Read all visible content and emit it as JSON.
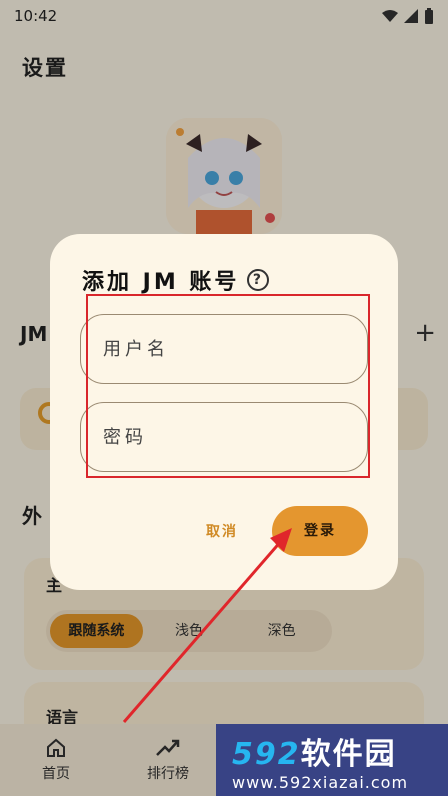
{
  "status_bar": {
    "time": "10:42"
  },
  "page": {
    "title": "设置",
    "section_jm": "JM",
    "section_appearance": "外",
    "theme_label": "主",
    "theme_options": [
      "跟随系统",
      "浅色",
      "深色"
    ],
    "language_label": "语言"
  },
  "bottom_nav": {
    "items": [
      {
        "label": "首页",
        "icon": "home-icon"
      },
      {
        "label": "排行榜",
        "icon": "trending-icon"
      }
    ]
  },
  "dialog": {
    "title": "添加 JM 账号",
    "username_placeholder": "用户名",
    "password_placeholder": "密码",
    "cancel_label": "取消",
    "login_label": "登录"
  },
  "watermark": {
    "logo_num": "592",
    "logo_text": "软件园",
    "url": "www.592xiazai.com"
  },
  "colors": {
    "accent": "#e4962f",
    "highlight": "#d9262b",
    "dialog_bg": "#fdf6e7"
  }
}
